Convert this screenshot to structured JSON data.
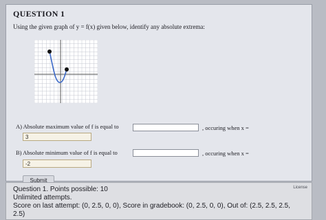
{
  "question": {
    "title": "QUESTION 1",
    "prompt": "Using the given graph of y = f(x) given below, identify any absolute extrema:"
  },
  "part_a": {
    "label": "A) Absolute maximum value of f is equal to",
    "input_value": "",
    "when_label": ", occuring when x =",
    "entered_value": "3"
  },
  "part_b": {
    "label": "B) Absolute minimum value of f is equal to",
    "input_value": "",
    "when_label": ", occuring when x =",
    "entered_value": "-2"
  },
  "submit_label": "Submit",
  "footer": {
    "line1": "Question 1. Points possible: 10",
    "line2": "Unlimited attempts.",
    "line3": "Score on last attempt: (0, 2.5, 0, 0), Score in gradebook: (0, 2.5, 0, 0), Out of: (2.5, 2.5, 2.5,",
    "line4": "2.5)",
    "license": "License"
  },
  "graph": {
    "curve_color": "#3a68c8",
    "point_color": "#111111",
    "grid_color": "#c4c7d0"
  }
}
